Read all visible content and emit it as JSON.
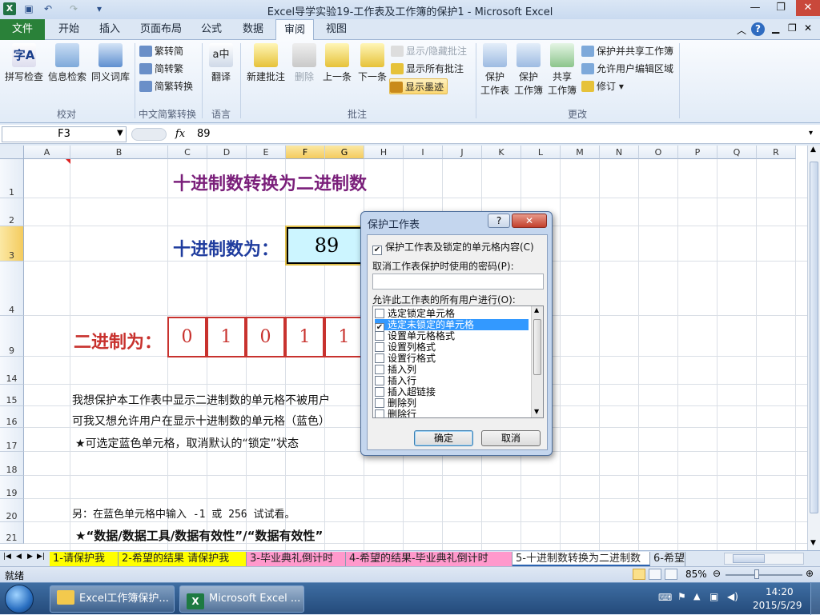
{
  "window": {
    "title": "Excel导学实验19-工作表及工作簿的保护1 - Microsoft Excel",
    "controls": {
      "minimize": "—",
      "restore": "❐",
      "close": "✕"
    }
  },
  "ribbon_tabs": [
    "文件",
    "开始",
    "插入",
    "页面布局",
    "公式",
    "数据",
    "审阅",
    "视图"
  ],
  "active_tab": "审阅",
  "ribbon": {
    "proof": {
      "spell": "拼写检查",
      "research": "信息检索",
      "thesaurus": "同义词库",
      "group": "校对"
    },
    "chinese": {
      "t2s": "繁转简",
      "s2t": "简转繁",
      "convert": "简繁转换",
      "group": "中文简繁转换"
    },
    "language": {
      "translate": "翻译",
      "group": "语言"
    },
    "comments": {
      "new": "新建批注",
      "delete": "删除",
      "prev": "上一条",
      "next": "下一条",
      "show_hide": "显示/隐藏批注",
      "show_all": "显示所有批注",
      "show_ink": "显示墨迹",
      "group": "批注"
    },
    "changes": {
      "protect_sheet": "保护\n工作表",
      "protect_book": "保护\n工作簿",
      "share_book": "共享\n工作簿",
      "protect_share": "保护并共享工作簿",
      "allow_edit": "允许用户编辑区域",
      "track": "修订",
      "group": "更改"
    }
  },
  "formula_bar": {
    "name_box": "F3",
    "fx": "fx",
    "value": "89"
  },
  "columns": [
    "A",
    "B",
    "C",
    "D",
    "E",
    "F",
    "G",
    "H",
    "I",
    "J",
    "K",
    "L",
    "M",
    "N",
    "O",
    "P",
    "Q",
    "R"
  ],
  "selected_columns": [
    "F",
    "G"
  ],
  "rows": [
    "1",
    "2",
    "3",
    "4",
    "9",
    "14",
    "15",
    "16",
    "17",
    "18",
    "19",
    "20",
    "21"
  ],
  "selected_row": "3",
  "sheet": {
    "heading": "十进制数转换为二进制数",
    "decimal_label": "十进制数为：",
    "decimal_value": "89",
    "binary_label": "二进制为：",
    "bits": [
      "0",
      "1",
      "0",
      "1",
      "1"
    ],
    "line15": "我想保护本工作表中显示二进制数的单元格不被用户",
    "line16": "可我又想允许用户在显示十进制数的单元格（蓝色）",
    "line17": "★可选定蓝色单元格，取消默认的“锁定”状态",
    "line20": "另：在蓝色单元格中输入 -1 或 256 试试看。",
    "line21": "★“数据/数据工具/数据有效性”/“数据有效性”"
  },
  "dialog": {
    "title": "保护工作表",
    "help": "?",
    "close": "✕",
    "protect_check": "保护工作表及锁定的单元格内容(C)",
    "password_label": "取消工作表保护时使用的密码(P):",
    "password_value": "",
    "allow_label": "允许此工作表的所有用户进行(O):",
    "options": [
      {
        "label": "选定锁定单元格",
        "checked": false,
        "selected": false
      },
      {
        "label": "选定未锁定的单元格",
        "checked": true,
        "selected": true
      },
      {
        "label": "设置单元格格式",
        "checked": false,
        "selected": false
      },
      {
        "label": "设置列格式",
        "checked": false,
        "selected": false
      },
      {
        "label": "设置行格式",
        "checked": false,
        "selected": false
      },
      {
        "label": "插入列",
        "checked": false,
        "selected": false
      },
      {
        "label": "插入行",
        "checked": false,
        "selected": false
      },
      {
        "label": "插入超链接",
        "checked": false,
        "selected": false
      },
      {
        "label": "删除列",
        "checked": false,
        "selected": false
      },
      {
        "label": "删除行",
        "checked": false,
        "selected": false
      }
    ],
    "ok": "确定",
    "cancel": "取消"
  },
  "sheet_tabs": [
    {
      "label": "1-请保护我",
      "color": "#ffff00"
    },
    {
      "label": "2-希望的结果 请保护我",
      "color": "#ffff00"
    },
    {
      "label": "3-毕业典礼倒计时",
      "color": "#ff99cc"
    },
    {
      "label": "4-希望的结果-毕业典礼倒计时",
      "color": "#ff99cc"
    },
    {
      "label": "5-十进制数转换为二进制数",
      "color": "#ffffff"
    },
    {
      "label": "6-希望",
      "color": "#dde7f3"
    }
  ],
  "status": {
    "ready": "就绪",
    "zoom": "85%"
  },
  "taskbar": {
    "items": [
      "Excel工作簿保护...",
      "Microsoft Excel ..."
    ],
    "time": "14:20",
    "date": "2015/5/29"
  }
}
